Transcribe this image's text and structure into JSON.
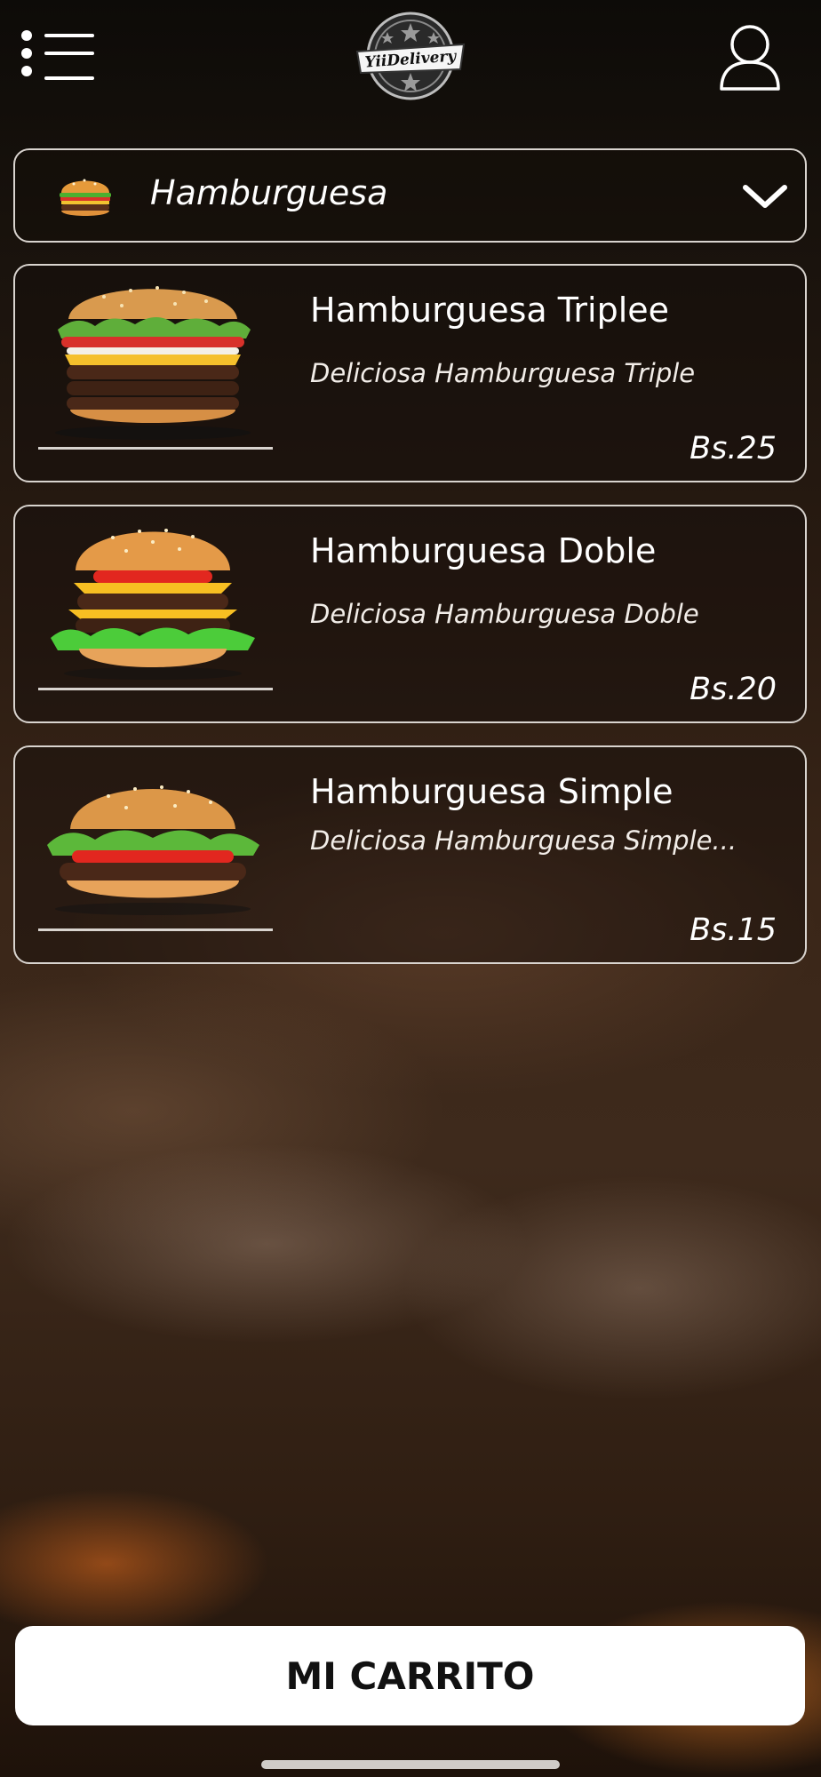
{
  "header": {
    "menu_icon": "menu-list-icon",
    "logo_text": "YiiDelivery",
    "user_icon": "user-profile-icon"
  },
  "category": {
    "icon": "hamburger-icon",
    "selected": "Hamburguesa",
    "chevron_icon": "chevron-down-icon"
  },
  "products": [
    {
      "name": "Hamburguesa Triplee",
      "description": "Deliciosa Hamburguesa Triple",
      "price": "Bs.25",
      "image": "triple-burger-image"
    },
    {
      "name": "Hamburguesa Doble",
      "description": "Deliciosa Hamburguesa Doble",
      "price": "Bs.20",
      "image": "double-burger-image"
    },
    {
      "name": "Hamburguesa Simple",
      "description": "Deliciosa Hamburguesa Simple...",
      "price": "Bs.15",
      "image": "simple-burger-image"
    }
  ],
  "cart": {
    "label": "MI CARRITO"
  },
  "colors": {
    "card_border": "#d9d4cf",
    "button_bg": "#ffffff",
    "button_text": "#111111"
  }
}
